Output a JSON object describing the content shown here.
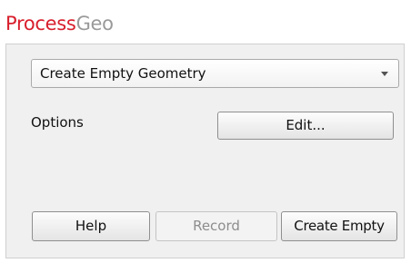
{
  "app": {
    "title_accent": "Process",
    "title_rest": "Geo"
  },
  "operation_select": {
    "selected": "Create Empty Geometry",
    "icon": "chevron-down-icon"
  },
  "options": {
    "label": "Options",
    "edit_label": "Edit..."
  },
  "buttons": {
    "help": "Help",
    "record": "Record",
    "record_disabled": true,
    "create": "Create Empty"
  },
  "colors": {
    "accent": "#d81e2c",
    "title_muted": "#9a9a9a",
    "panel_background": "#f0f0f0",
    "disabled_text": "#8d8d8d"
  }
}
